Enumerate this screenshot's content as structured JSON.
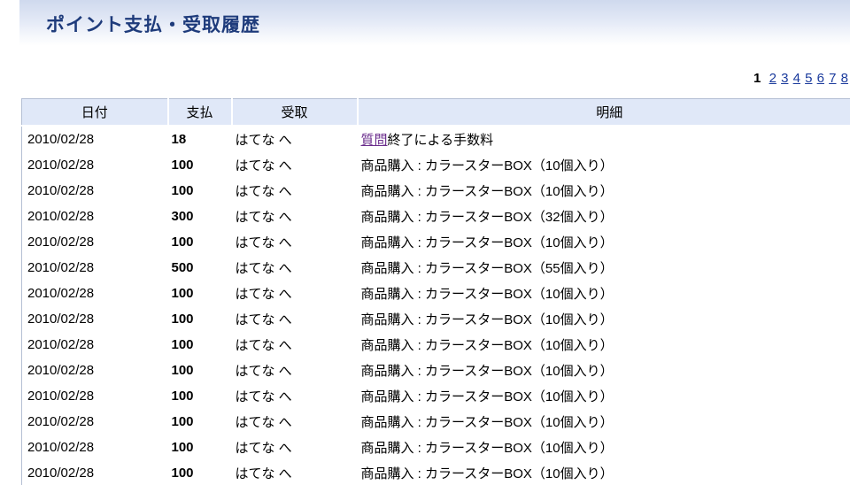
{
  "page_title": "ポイント支払・受取履歴",
  "pager": {
    "current": "1",
    "pages": [
      "2",
      "3",
      "4",
      "5",
      "6",
      "7",
      "8"
    ]
  },
  "table": {
    "headers": [
      "日付",
      "支払",
      "受取",
      "明細"
    ],
    "rows": [
      {
        "date": "2010/02/28",
        "pay": "18",
        "recv": "はてな へ",
        "detail_link": "質問",
        "detail": "終了による手数料"
      },
      {
        "date": "2010/02/28",
        "pay": "100",
        "recv": "はてな へ",
        "detail_link": "",
        "detail": "商品購入 : カラースターBOX（10個入り）"
      },
      {
        "date": "2010/02/28",
        "pay": "100",
        "recv": "はてな へ",
        "detail_link": "",
        "detail": "商品購入 : カラースターBOX（10個入り）"
      },
      {
        "date": "2010/02/28",
        "pay": "300",
        "recv": "はてな へ",
        "detail_link": "",
        "detail": "商品購入 : カラースターBOX（32個入り）"
      },
      {
        "date": "2010/02/28",
        "pay": "100",
        "recv": "はてな へ",
        "detail_link": "",
        "detail": "商品購入 : カラースターBOX（10個入り）"
      },
      {
        "date": "2010/02/28",
        "pay": "500",
        "recv": "はてな へ",
        "detail_link": "",
        "detail": "商品購入 : カラースターBOX（55個入り）"
      },
      {
        "date": "2010/02/28",
        "pay": "100",
        "recv": "はてな へ",
        "detail_link": "",
        "detail": "商品購入 : カラースターBOX（10個入り）"
      },
      {
        "date": "2010/02/28",
        "pay": "100",
        "recv": "はてな へ",
        "detail_link": "",
        "detail": "商品購入 : カラースターBOX（10個入り）"
      },
      {
        "date": "2010/02/28",
        "pay": "100",
        "recv": "はてな へ",
        "detail_link": "",
        "detail": "商品購入 : カラースターBOX（10個入り）"
      },
      {
        "date": "2010/02/28",
        "pay": "100",
        "recv": "はてな へ",
        "detail_link": "",
        "detail": "商品購入 : カラースターBOX（10個入り）"
      },
      {
        "date": "2010/02/28",
        "pay": "100",
        "recv": "はてな へ",
        "detail_link": "",
        "detail": "商品購入 : カラースターBOX（10個入り）"
      },
      {
        "date": "2010/02/28",
        "pay": "100",
        "recv": "はてな へ",
        "detail_link": "",
        "detail": "商品購入 : カラースターBOX（10個入り）"
      },
      {
        "date": "2010/02/28",
        "pay": "100",
        "recv": "はてな へ",
        "detail_link": "",
        "detail": "商品購入 : カラースターBOX（10個入り）"
      },
      {
        "date": "2010/02/28",
        "pay": "100",
        "recv": "はてな へ",
        "detail_link": "",
        "detail": "商品購入 : カラースターBOX（10個入り）"
      }
    ]
  },
  "colors": {
    "title": "#1e3b7b",
    "header_bg": "#e0e8f8",
    "link": "#1a3a9c",
    "visited_link": "#6a2c8c"
  }
}
